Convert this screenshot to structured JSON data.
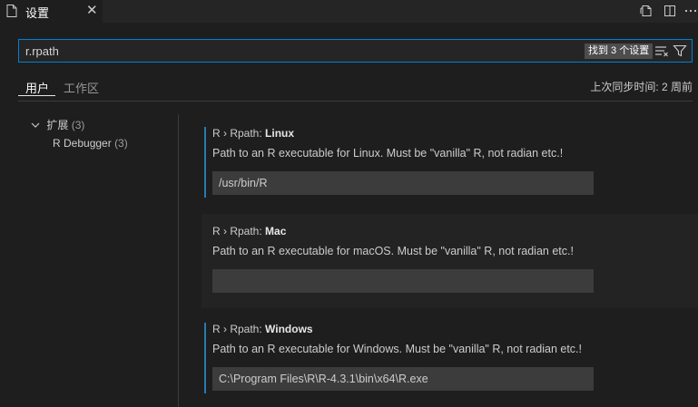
{
  "tab": {
    "title": "设置",
    "close": "✕",
    "icon": "settings-file-icon"
  },
  "editor_actions": [
    {
      "name": "open-settings-json-icon"
    },
    {
      "name": "split-editor-icon"
    },
    {
      "name": "more-actions-icon"
    }
  ],
  "search": {
    "query": "r.rpath",
    "result_count": "找到 3 个设置"
  },
  "scopes": {
    "user": "用户",
    "workspace": "工作区"
  },
  "sync_status": "上次同步时间: 2 周前",
  "toc": {
    "group": {
      "label": "扩展",
      "count": "(3)"
    },
    "item": {
      "label": "R Debugger",
      "count": "(3)"
    }
  },
  "settings": [
    {
      "category": "R › Rpath: ",
      "name": "Linux",
      "description": "Path to an R executable for Linux. Must be \"vanilla\" R, not radian etc.!",
      "value": "/usr/bin/R"
    },
    {
      "category": "R › Rpath: ",
      "name": "Mac",
      "description": "Path to an R executable for macOS. Must be \"vanilla\" R, not radian etc.!",
      "value": ""
    },
    {
      "category": "R › Rpath: ",
      "name": "Windows",
      "description": "Path to an R executable for Windows. Must be \"vanilla\" R, not radian etc.!",
      "value": "C:\\Program Files\\R\\R-4.3.1\\bin\\x64\\R.exe"
    }
  ],
  "colors": {
    "accent": "#007fd4",
    "modified_bar": "#2a7ab0",
    "count_badge": "#4d4d4d"
  }
}
